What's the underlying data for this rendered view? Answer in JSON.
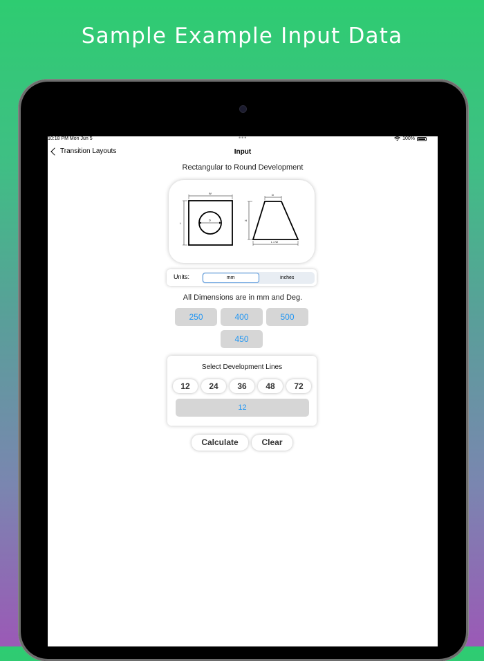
{
  "promo": {
    "title": "Sample Example Input Data"
  },
  "status": {
    "time": "10:18 PM   Mon Jun 5",
    "dots": "•••",
    "battery": "100%"
  },
  "nav": {
    "back_label": "Transition Layouts",
    "title": "Input"
  },
  "main": {
    "heading": "Rectangular to Round Development",
    "diagram": {
      "width_label": "W",
      "length_label": "L",
      "diameter_label": "D",
      "height_label": "H",
      "top_label": "D",
      "base_label": "L x W"
    },
    "units": {
      "label": "Units:",
      "options": [
        "mm",
        "inches"
      ],
      "selected": "mm"
    },
    "dimensions_note": "All Dimensions are in mm and Deg.",
    "inputs": [
      "250",
      "400",
      "500",
      "450"
    ],
    "development": {
      "title": "Select Development Lines",
      "options": [
        "12",
        "24",
        "36",
        "48",
        "72"
      ],
      "value": "12"
    },
    "buttons": {
      "calculate": "Calculate",
      "clear": "Clear"
    }
  },
  "colors": {
    "accent": "#2196f3",
    "input_bg": "#d6d6d6",
    "gradient_top": "#2ecc71",
    "gradient_bottom": "#9b59b6"
  }
}
